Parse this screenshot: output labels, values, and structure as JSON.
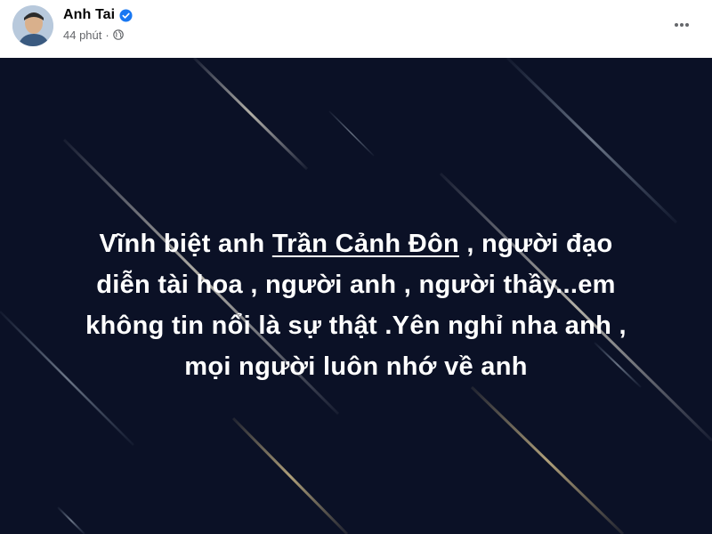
{
  "post": {
    "author": {
      "name": "Anh Tai",
      "verified": true,
      "avatar_icon": "avatar-photo"
    },
    "meta": {
      "time": "44 phút",
      "separator": "·",
      "privacy_icon": "globe-icon"
    },
    "more_icon": "more-horizontal-icon",
    "image_text": {
      "line1_before": "Vĩnh biệt anh ",
      "mention": "Trần Cảnh Đôn",
      "line1_after": " , người đạo",
      "line2": "diễn tài hoa , người anh , người thầy...em",
      "line3": "không tin nổi là sự thật .Yên nghỉ nha anh ,",
      "line4": "mọi người luôn nhớ về anh"
    },
    "colors": {
      "background": "#0b1126",
      "text": "#ffffff",
      "verified": "#1877f2",
      "meta": "#65676b"
    }
  }
}
